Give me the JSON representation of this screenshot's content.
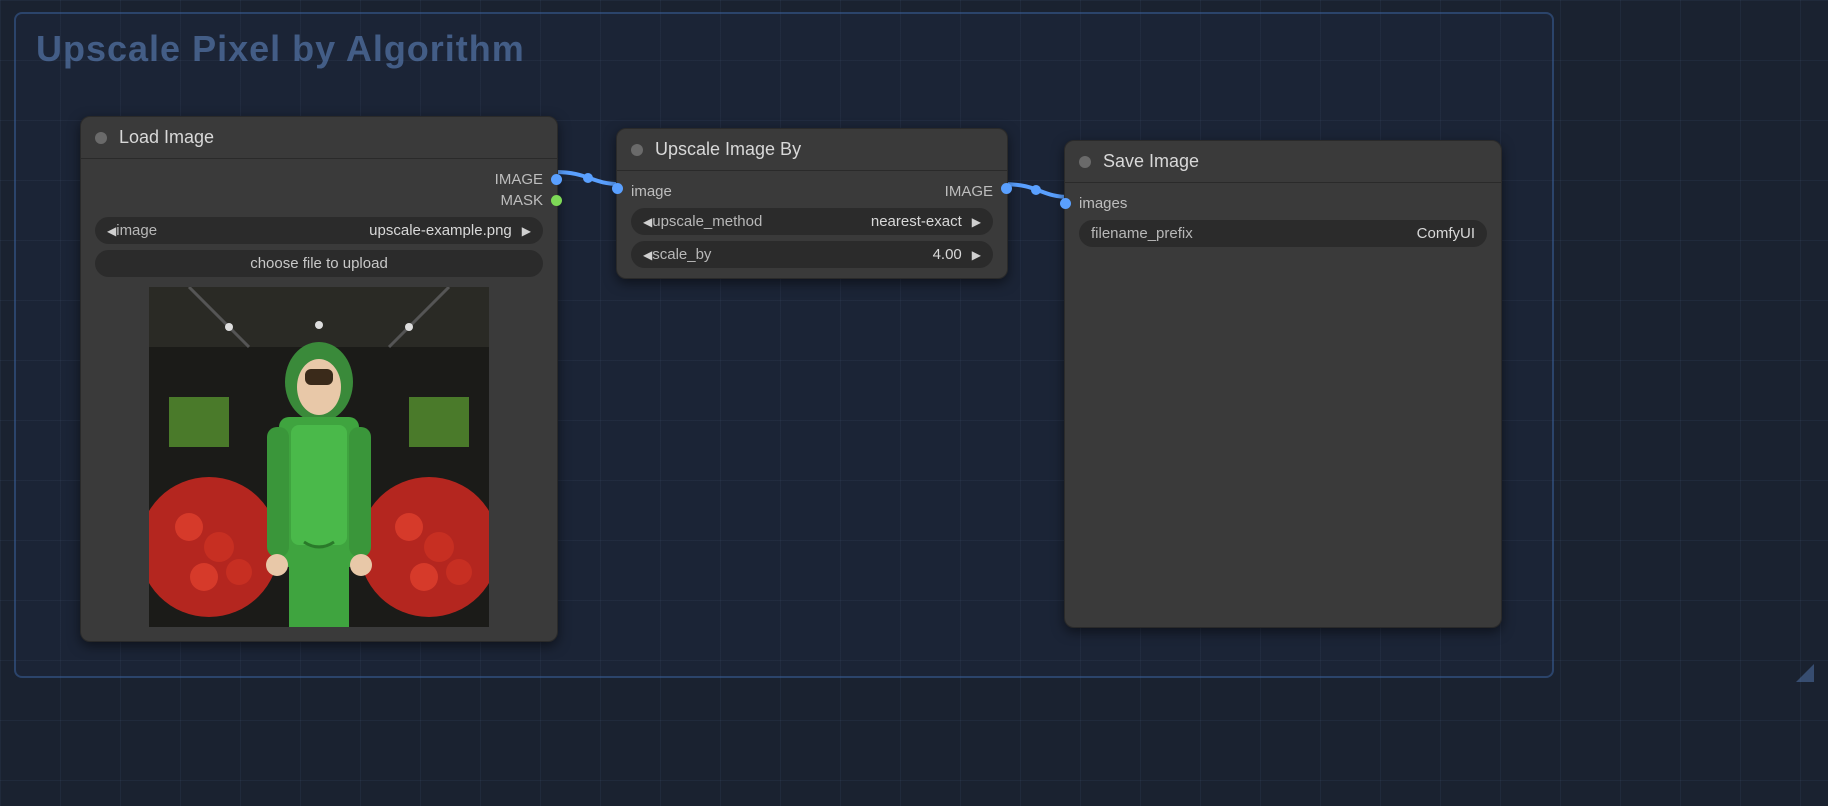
{
  "group": {
    "title": "Upscale Pixel by Algorithm"
  },
  "nodes": {
    "load": {
      "title": "Load Image",
      "outputs": [
        "IMAGE",
        "MASK"
      ],
      "widgets": {
        "image_label": "image",
        "image_value": "upscale-example.png",
        "upload_label": "choose file to upload"
      }
    },
    "upscale": {
      "title": "Upscale Image By",
      "input": "image",
      "output": "IMAGE",
      "widgets": {
        "method_label": "upscale_method",
        "method_value": "nearest-exact",
        "scale_label": "scale_by",
        "scale_value": "4.00"
      }
    },
    "save": {
      "title": "Save Image",
      "input": "images",
      "widgets": {
        "prefix_label": "filename_prefix",
        "prefix_value": "ComfyUI"
      }
    }
  }
}
